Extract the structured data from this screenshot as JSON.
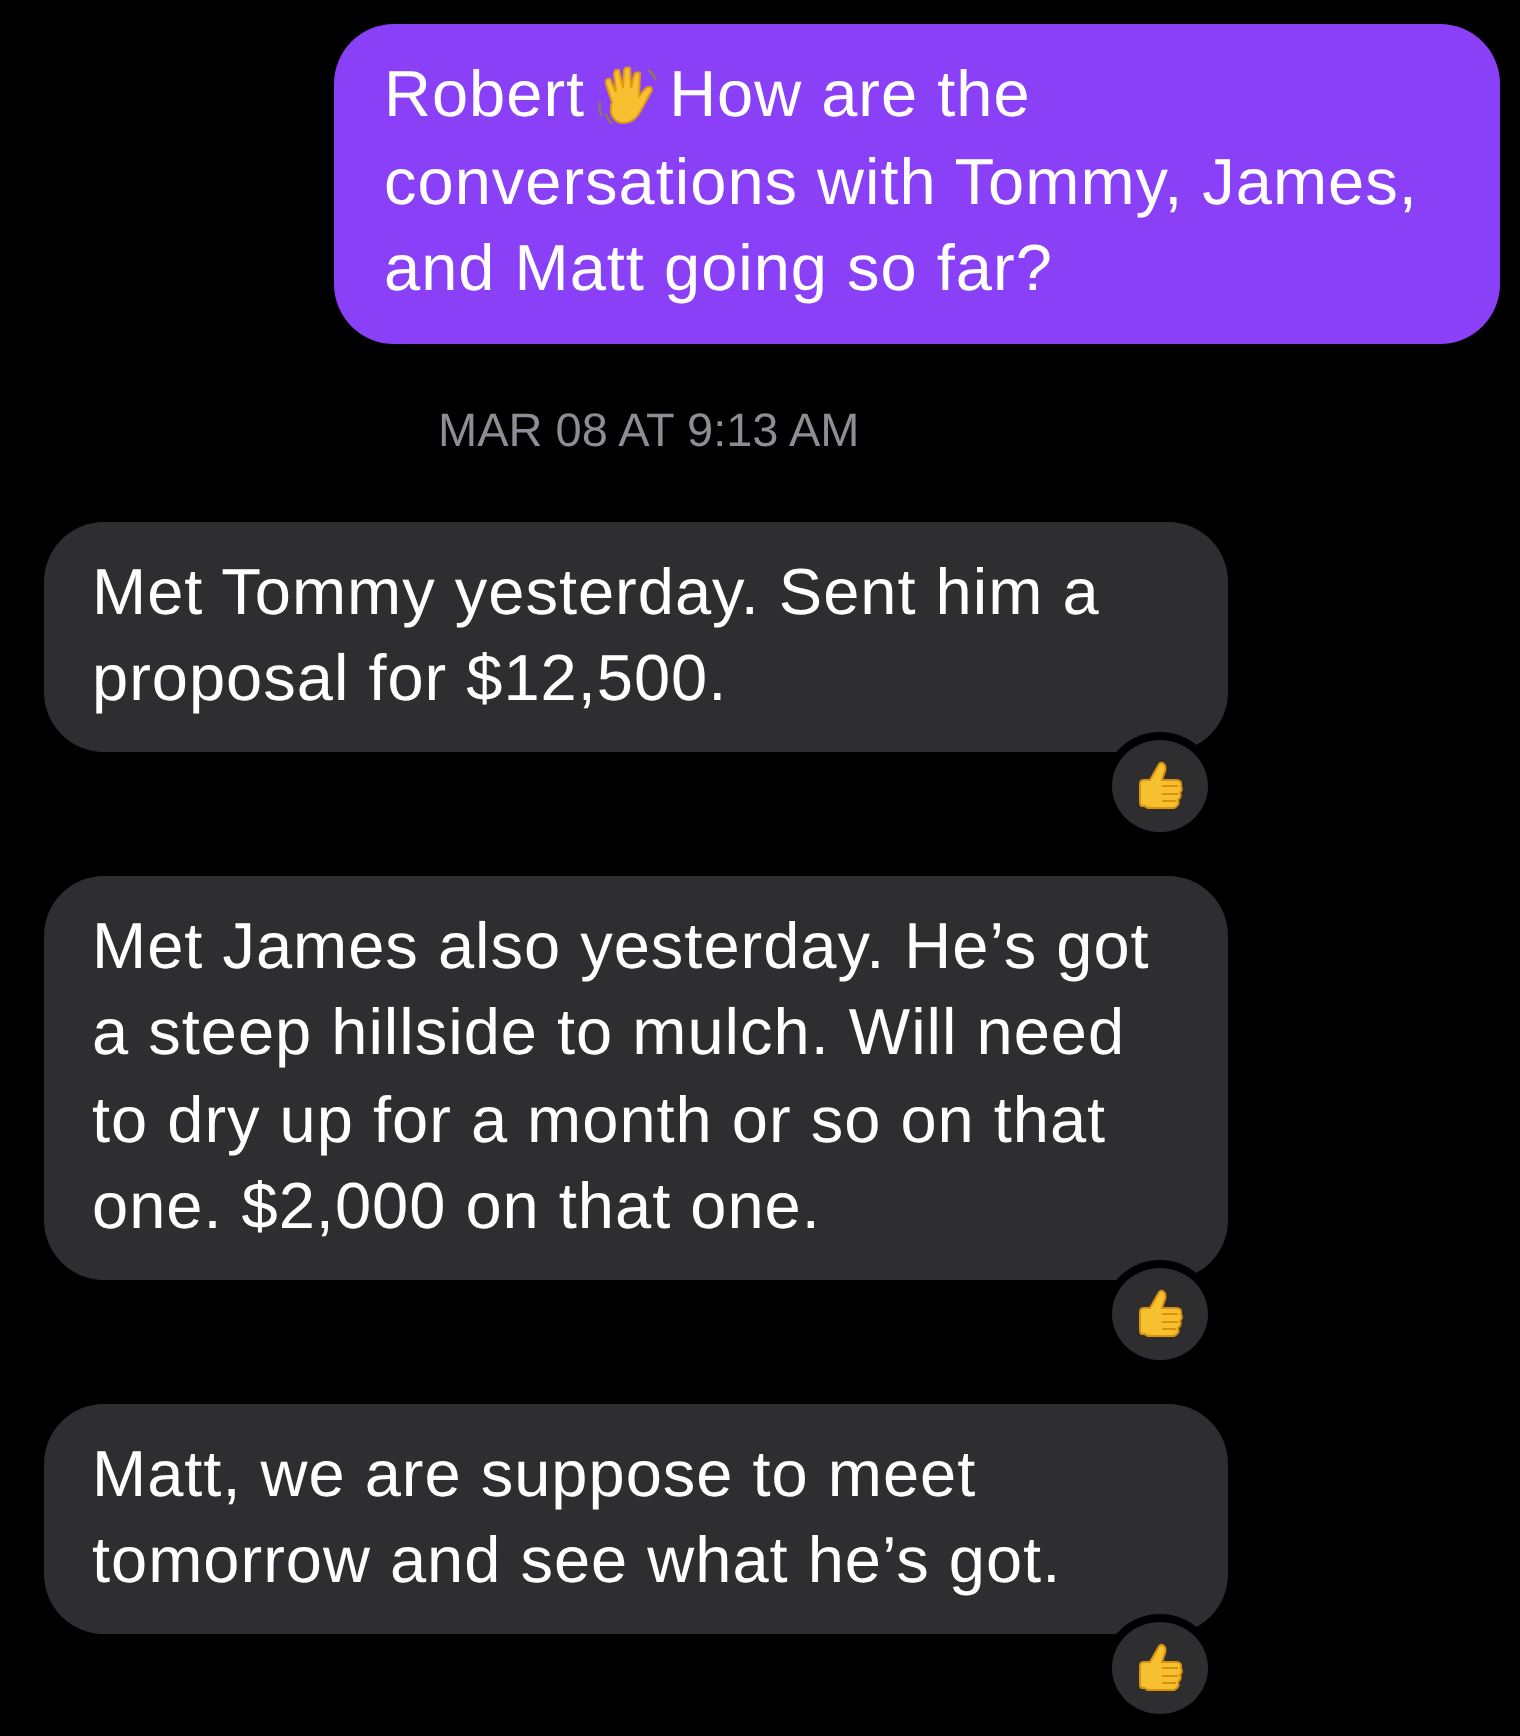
{
  "messages": [
    {
      "kind": "outgoing",
      "name": "Robert",
      "lines": [
        "How are the",
        "conversations with Tommy, James,",
        "and Matt going so far?"
      ],
      "reacted": false
    },
    {
      "kind": "timestamp",
      "text": "MAR 08 AT 9:13 AM"
    },
    {
      "kind": "incoming",
      "text": "Met Tommy yesterday. Sent him a proposal for $12,500.",
      "reacted": true
    },
    {
      "kind": "incoming",
      "text": "Met James also yesterday. He’s got a steep hillside to mulch. Will need to dry up for a month or so on that one. $2,000 on that one.",
      "reacted": true
    },
    {
      "kind": "incoming",
      "text": "Matt, we are suppose to meet tomorrow and see what he’s got.",
      "reacted": true
    }
  ]
}
